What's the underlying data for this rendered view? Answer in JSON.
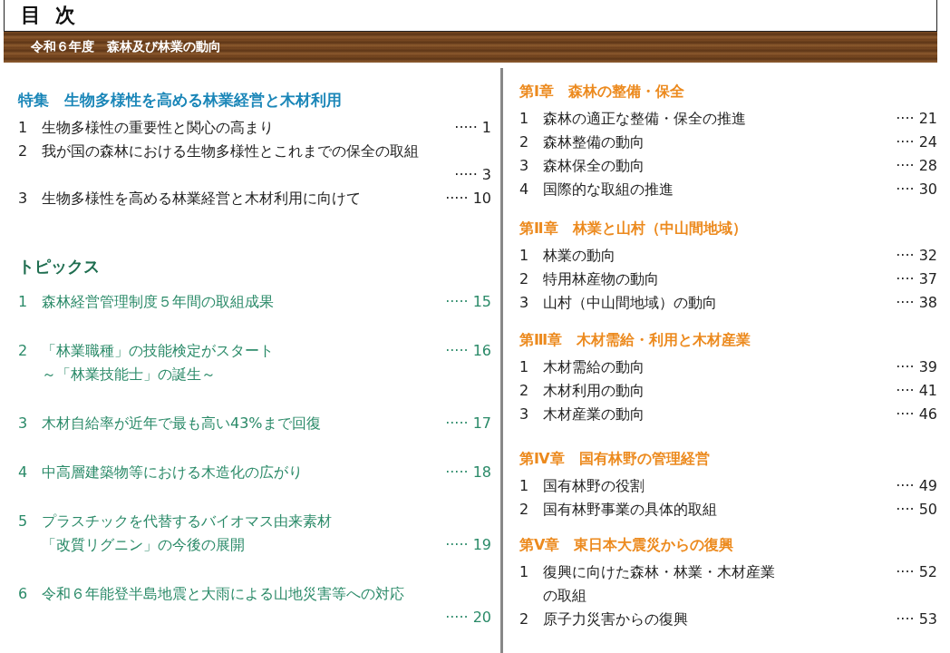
{
  "title": "目 次",
  "banner": "令和６年度　森林及び林業の動向",
  "feature": {
    "title": "特集　生物多様性を高める林業経営と木材利用",
    "items": [
      {
        "number": "1",
        "lines": [
          "生物多様性の重要性と関心の高まり"
        ],
        "page": "····· 1"
      },
      {
        "number": "2",
        "lines": [
          "我が国の森林における生物多様性とこれまでの保全の取組"
        ],
        "page": "····· 3",
        "kind": "below"
      },
      {
        "number": "3",
        "lines": [
          "生物多様性を高める林業経営と木材利用に向けて"
        ],
        "page": "····· 10"
      }
    ]
  },
  "topics": {
    "title": "トピックス",
    "items": [
      {
        "number": "1",
        "lines": [
          "森林経営管理制度５年間の取組成果"
        ],
        "page": "····· 15"
      },
      {
        "number": "2",
        "lines": [
          "「林業職種」の技能検定がスタート",
          "～「林業技能士」の誕生～"
        ],
        "page": "····· 16",
        "kind": "top"
      },
      {
        "number": "3",
        "lines": [
          "木材自給率が近年で最も高い43%まで回復"
        ],
        "page": "····· 17"
      },
      {
        "number": "4",
        "lines": [
          "中高層建築物等における木造化の広がり"
        ],
        "page": "····· 18"
      },
      {
        "number": "5",
        "lines": [
          "プラスチックを代替するバイオマス由来素材",
          "「改質リグニン」の今後の展開"
        ],
        "page": "····· 19",
        "kind": "bottom"
      },
      {
        "number": "6",
        "lines": [
          "令和６年能登半島地震と大雨による山地災害等への対応"
        ],
        "page": "····· 20",
        "kind": "below"
      }
    ]
  },
  "chapters": [
    {
      "title": "第Ⅰ章　森林の整備・保全",
      "items": [
        {
          "number": "1",
          "lines": [
            "森林の適正な整備・保全の推進"
          ],
          "page": "···· 21"
        },
        {
          "number": "2",
          "lines": [
            "森林整備の動向"
          ],
          "page": "···· 24"
        },
        {
          "number": "3",
          "lines": [
            "森林保全の動向"
          ],
          "page": "···· 28"
        },
        {
          "number": "4",
          "lines": [
            "国際的な取組の推進"
          ],
          "page": "···· 30"
        }
      ]
    },
    {
      "title": "第Ⅱ章　林業と山村（中山間地域）",
      "items": [
        {
          "number": "1",
          "lines": [
            "林業の動向"
          ],
          "page": "···· 32"
        },
        {
          "number": "2",
          "lines": [
            "特用林産物の動向"
          ],
          "page": "···· 37"
        },
        {
          "number": "3",
          "lines": [
            "山村（中山間地域）の動向"
          ],
          "page": "···· 38"
        }
      ]
    },
    {
      "title": "第Ⅲ章　木材需給・利用と木材産業",
      "items": [
        {
          "number": "1",
          "lines": [
            "木材需給の動向"
          ],
          "page": "···· 39"
        },
        {
          "number": "2",
          "lines": [
            "木材利用の動向"
          ],
          "page": "···· 41"
        },
        {
          "number": "3",
          "lines": [
            "木材産業の動向"
          ],
          "page": "···· 46"
        }
      ]
    },
    {
      "title": "第Ⅳ章　国有林野の管理経営",
      "items": [
        {
          "number": "1",
          "lines": [
            "国有林野の役割"
          ],
          "page": "···· 49"
        },
        {
          "number": "2",
          "lines": [
            "国有林野事業の具体的取組"
          ],
          "page": "···· 50"
        }
      ]
    },
    {
      "title": "第Ⅴ章　東日本大震災からの復興",
      "items": [
        {
          "number": "1",
          "lines": [
            "復興に向けた森林・林業・木材産業",
            "の取組"
          ],
          "page": "···· 52"
        },
        {
          "number": "2",
          "lines": [
            "原子力災害からの復興"
          ],
          "page": "···· 53"
        }
      ]
    }
  ]
}
